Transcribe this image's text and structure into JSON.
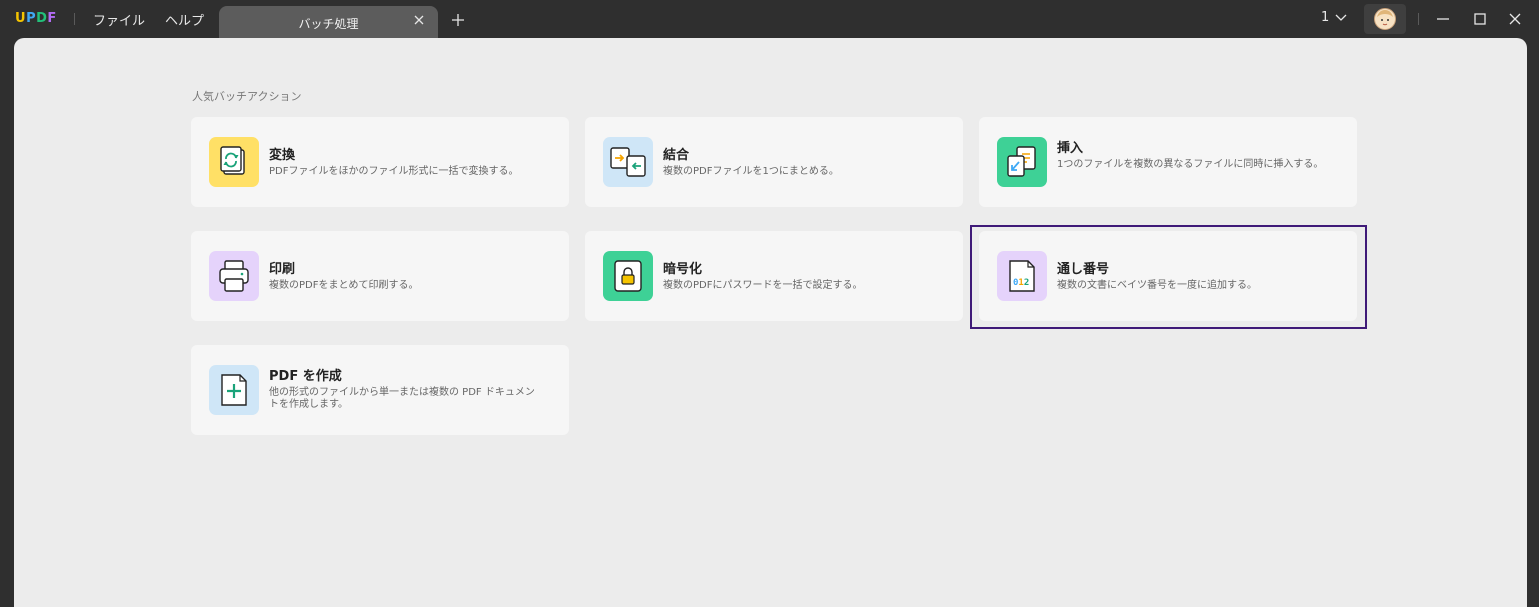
{
  "titlebar": {
    "logo": "UPDF",
    "logo_colors": [
      "#f5c400",
      "#3fa9f5",
      "#22c07a",
      "#b36cf5"
    ],
    "menu": [
      "ファイル",
      "ヘルプ"
    ],
    "active_tab": "バッチ処理",
    "page_indicator": "1",
    "icons": [
      "chevron-down-icon",
      "avatar-icon",
      "minimize-icon",
      "maximize-icon",
      "close-icon",
      "plus-icon"
    ]
  },
  "main": {
    "section_title": "人気バッチアクション",
    "cards": [
      {
        "title": "変換",
        "desc": "PDFファイルをほかのファイル形式に一括で変換する。",
        "icon": "convert-icon",
        "color": "#ffe066"
      },
      {
        "title": "結合",
        "desc": "複数のPDFファイルを1つにまとめる。",
        "icon": "merge-icon",
        "color": "#cfe6f7"
      },
      {
        "title": "挿入",
        "desc": "1つのファイルを複数の異なるファイルに同時に挿入する。",
        "icon": "insert-icon",
        "color": "#3ed196"
      },
      {
        "title": "印刷",
        "desc": "複数のPDFをまとめて印刷する。",
        "icon": "printer-icon",
        "color": "#e5d3fb"
      },
      {
        "title": "暗号化",
        "desc": "複数のPDFにパスワードを一括で設定する。",
        "icon": "lock-icon",
        "color": "#3ed196"
      },
      {
        "title": "通し番号",
        "desc": "複数の文書にベイツ番号を一度に追加する。",
        "icon": "bates-number-icon",
        "color": "#e5d3fb"
      },
      {
        "title": "PDF を作成",
        "desc": "他の形式のファイルから単一または複数の PDF ドキュメントを作成します。",
        "icon": "create-pdf-icon",
        "color": "#cfe6f7"
      }
    ],
    "bates_icon_text": "012"
  }
}
